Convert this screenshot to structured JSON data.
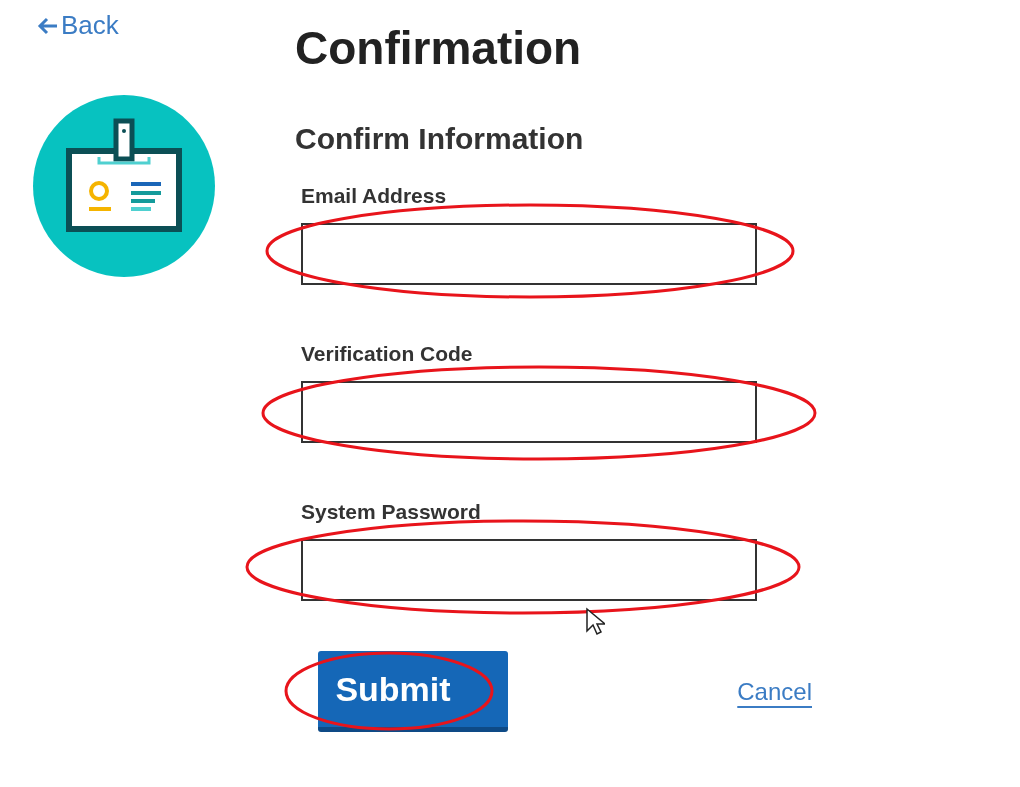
{
  "back_link": {
    "label": "Back"
  },
  "title": "Confirmation",
  "section_title": "Confirm Information",
  "fields": [
    {
      "label": "Email Address",
      "circled": true
    },
    {
      "label": "Verification Code",
      "circled": true
    },
    {
      "label": "System Password",
      "circled": true
    }
  ],
  "submit_button": {
    "label": "Submit",
    "circled": true
  },
  "cancel_link": {
    "label": "Cancel"
  }
}
